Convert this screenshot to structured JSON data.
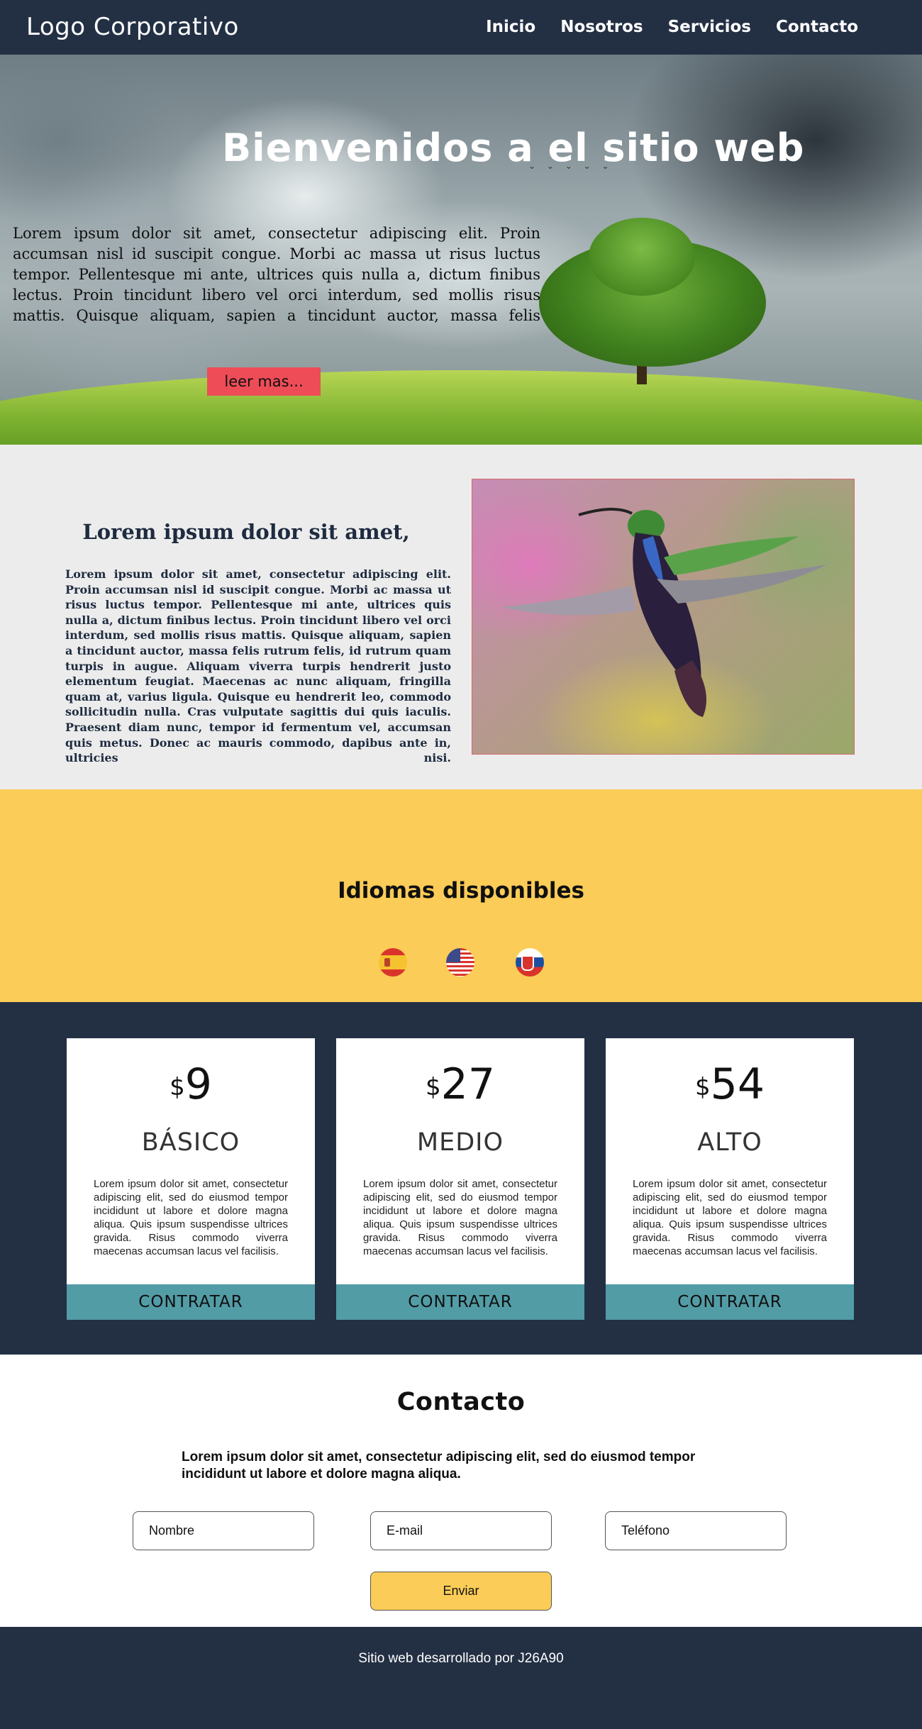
{
  "header": {
    "logo": "Logo Corporativo",
    "nav": [
      "Inicio",
      "Nosotros",
      "Servicios",
      "Contacto"
    ]
  },
  "hero": {
    "title": "Bienvenidos a el sitio web",
    "text": "Lorem ipsum dolor sit amet, consectetur adipiscing elit. Proin accumsan nisl id suscipit congue. Morbi ac massa ut risus luctus tempor. Pellentesque mi ante, ultrices quis nulla a, dictum finibus lectus. Proin tincidunt libero vel orci interdum, sed mollis risus mattis. Quisque aliquam, sapien a tincidunt auctor, massa felis rutrum felis, id rutrum",
    "button": "leer mas..."
  },
  "about": {
    "title": "Lorem ipsum dolor sit amet,",
    "text": "Lorem ipsum dolor sit amet, consectetur adipiscing elit. Proin accumsan nisl id suscipit congue. Morbi ac massa ut risus luctus tempor. Pellentesque mi ante, ultrices quis nulla a, dictum finibus lectus. Proin tincidunt libero vel orci interdum, sed mollis risus mattis. Quisque aliquam, sapien a tincidunt auctor, massa felis rutrum felis, id rutrum quam turpis in augue. Aliquam viverra turpis hendrerit justo elementum feugiat. Maecenas ac nunc aliquam, fringilla quam at, varius ligula. Quisque eu hendrerit leo, commodo sollicitudin nulla. Cras vulputate sagittis dui quis iaculis. Praesent diam nunc, tempor id fermentum vel, accumsan quis metus. Donec ac mauris commodo, dapibus ante in, ultricies nisi."
  },
  "languages": {
    "title": "Idiomas disponibles",
    "flags": [
      "spain-flag-icon",
      "usa-flag-icon",
      "slovakia-flag-icon"
    ]
  },
  "pricing": {
    "currency": "$",
    "plans": [
      {
        "price": "9",
        "name": "BÁSICO",
        "desc": "Lorem ipsum dolor sit amet, consectetur adipiscing elit, sed do eiusmod tempor incididunt ut labore et dolore magna aliqua. Quis ipsum suspendisse ultrices gravida. Risus commodo viverra maecenas accumsan lacus vel facilisis.",
        "button": "CONTRATAR"
      },
      {
        "price": "27",
        "name": "MEDIO",
        "desc": "Lorem ipsum dolor sit amet, consectetur adipiscing elit, sed do eiusmod tempor incididunt ut labore et dolore magna aliqua. Quis ipsum suspendisse ultrices gravida. Risus commodo viverra maecenas accumsan lacus vel facilisis.",
        "button": "CONTRATAR"
      },
      {
        "price": "54",
        "name": "ALTO",
        "desc": "Lorem ipsum dolor sit amet, consectetur adipiscing elit, sed do eiusmod tempor incididunt ut labore et dolore magna aliqua. Quis ipsum suspendisse ultrices gravida. Risus commodo viverra maecenas accumsan lacus vel facilisis.",
        "button": "CONTRATAR"
      }
    ]
  },
  "contact": {
    "title": "Contacto",
    "text": "Lorem ipsum dolor sit amet, consectetur adipiscing elit, sed do eiusmod tempor incididunt ut labore et dolore magna aliqua.",
    "fields": {
      "name": "Nombre",
      "email": "E-mail",
      "phone": "Teléfono"
    },
    "submit": "Enviar"
  },
  "footer": {
    "text": "Sitio web desarrollado por J26A90"
  },
  "colors": {
    "navy": "#233044",
    "accent_yellow": "#fbcc57",
    "accent_teal": "#529ca6",
    "button_red": "#ee4c57",
    "section_gray": "#ececec"
  }
}
